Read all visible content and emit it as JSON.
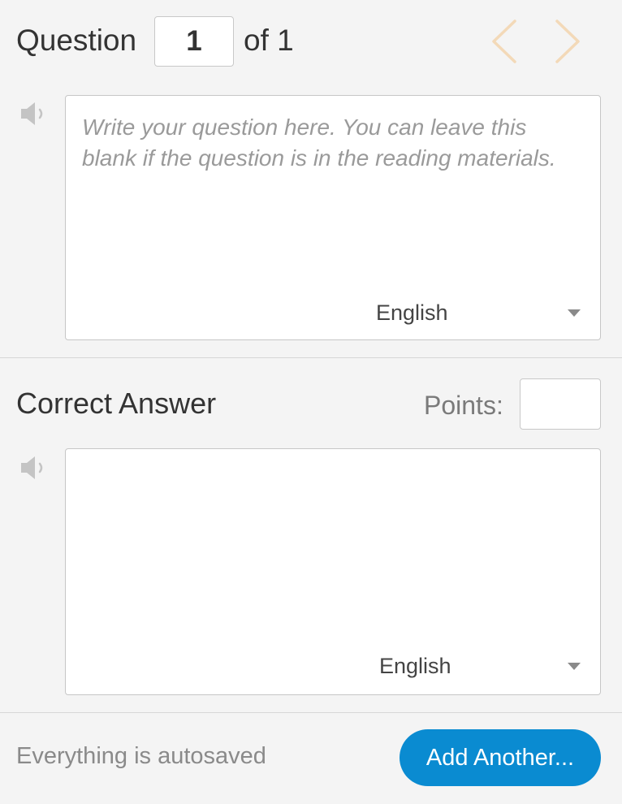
{
  "header": {
    "question_label": "Question",
    "question_number": "1",
    "of_total": "of 1"
  },
  "question": {
    "placeholder": "Write your question here. You can leave this blank if the question is in the reading materials.",
    "language": "English"
  },
  "answer": {
    "label": "Correct Answer",
    "points_label": "Points:",
    "points_value": "",
    "language": "English"
  },
  "footer": {
    "status": "Everything is autosaved",
    "add_button_label": "Add Another..."
  },
  "icons": {
    "prev": "chevron-left-icon",
    "next": "chevron-right-icon",
    "speaker": "speaker-icon"
  },
  "colors": {
    "background": "#f4f4f4",
    "nav_arrow": "#f3d9b8",
    "primary_button": "#0a8bd1",
    "placeholder_text": "#9a9a9a"
  }
}
